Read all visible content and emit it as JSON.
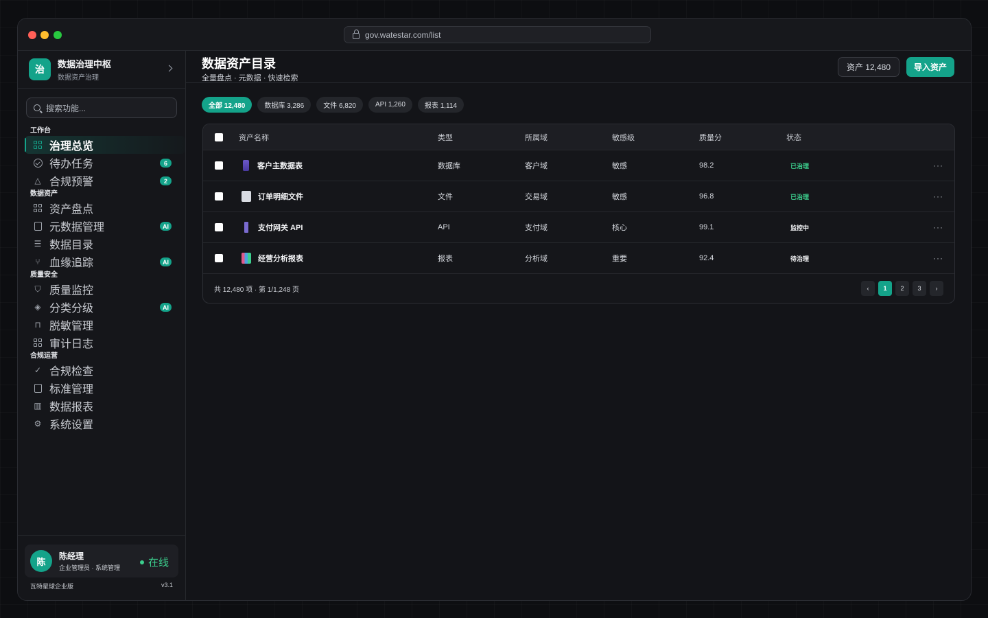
{
  "browser": {
    "url": "gov.watestar.com/list"
  },
  "brand": {
    "logo": "治",
    "name": "数据治理中枢",
    "sub": "数据资产治理"
  },
  "search": {
    "placeholder": "搜索功能..."
  },
  "sidebar": {
    "sections": [
      {
        "label": "工作台",
        "items": [
          {
            "label": "治理总览",
            "icon": "grid-icon",
            "active": true
          },
          {
            "label": "待办任务",
            "icon": "check-circle-icon",
            "badge": "6"
          },
          {
            "label": "合规预警",
            "icon": "warning-icon",
            "badge": "2"
          }
        ]
      },
      {
        "label": "数据资产",
        "items": [
          {
            "label": "资产盘点",
            "icon": "grid-icon"
          },
          {
            "label": "元数据管理",
            "icon": "book-icon",
            "badge": "AI"
          },
          {
            "label": "数据目录",
            "icon": "list-icon"
          },
          {
            "label": "血缘追踪",
            "icon": "branch-icon",
            "badge": "AI"
          }
        ]
      },
      {
        "label": "质量安全",
        "items": [
          {
            "label": "质量监控",
            "icon": "shield-icon"
          },
          {
            "label": "分类分级",
            "icon": "layers-icon",
            "badge": "AI"
          },
          {
            "label": "脱敏管理",
            "icon": "lock-icon"
          },
          {
            "label": "审计日志",
            "icon": "grid-icon"
          }
        ]
      },
      {
        "label": "合规运营",
        "items": [
          {
            "label": "合规检查",
            "icon": "check-icon"
          },
          {
            "label": "标准管理",
            "icon": "book-icon"
          },
          {
            "label": "数据报表",
            "icon": "bar-chart-icon"
          },
          {
            "label": "系统设置",
            "icon": "gear-icon"
          }
        ]
      }
    ]
  },
  "user": {
    "avatar": "陈",
    "name": "陈经理",
    "role": "企业管理员 · 系统管理",
    "status": "在线"
  },
  "footer": {
    "edition": "瓦特星球企业版",
    "version": "v3.1"
  },
  "header": {
    "title": "数据资产目录",
    "subtitle": "全量盘点 · 元数据 · 快速检索",
    "count_btn": "资产 12,480",
    "import_btn": "导入资产"
  },
  "filters": [
    "全部 12,480",
    "数据库 3,286",
    "文件 6,820",
    "API 1,260",
    "报表 1,114"
  ],
  "table": {
    "columns": [
      "资产名称",
      "类型",
      "所属域",
      "敏感级",
      "质量分",
      "状态"
    ],
    "rows": [
      {
        "icon": "database-icon",
        "name": "客户主数据表",
        "type": "数据库",
        "domain": "客户域",
        "sensitivity": "敏感",
        "score": "98.2",
        "status": "已治理",
        "status_color": "#3ccf8e"
      },
      {
        "icon": "document-icon",
        "name": "订单明细文件",
        "type": "文件",
        "domain": "交易域",
        "sensitivity": "敏感",
        "score": "96.8",
        "status": "已治理",
        "status_color": "#3ccf8e"
      },
      {
        "icon": "plug-icon",
        "name": "支付网关 API",
        "type": "API",
        "domain": "支付域",
        "sensitivity": "核心",
        "score": "99.1",
        "status": "监控中",
        "status_color": "#f3f4f6"
      },
      {
        "icon": "chart-icon",
        "name": "经营分析报表",
        "type": "报表",
        "domain": "分析域",
        "sensitivity": "重要",
        "score": "92.4",
        "status": "待治理",
        "status_color": "#f3f4f6"
      }
    ],
    "summary": "共 12,480 项 · 第 1/1,248 页",
    "pager": {
      "prev": "‹",
      "pages": [
        "1",
        "2",
        "3"
      ],
      "next": "›",
      "current": "1"
    }
  },
  "colors": {
    "accent": "#14a38a",
    "success": "#3ccf8e"
  }
}
